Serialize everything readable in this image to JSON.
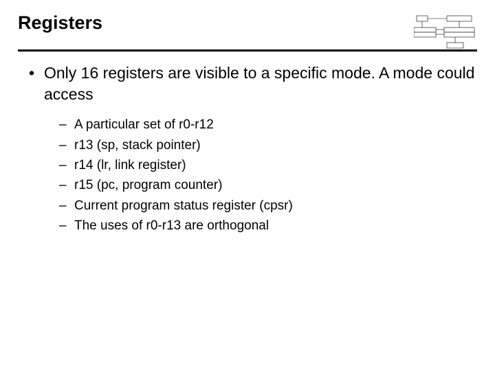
{
  "title": "Registers",
  "main_bullet": "Only 16 registers are visible to a specific mode. A mode could access",
  "sub_bullets": [
    "A particular set of r0-r12",
    "r13 (sp, stack pointer)",
    "r14 (lr, link register)",
    "r15 (pc, program counter)",
    "Current program status register (cpsr)",
    "The uses of r0-r13 are orthogonal"
  ]
}
